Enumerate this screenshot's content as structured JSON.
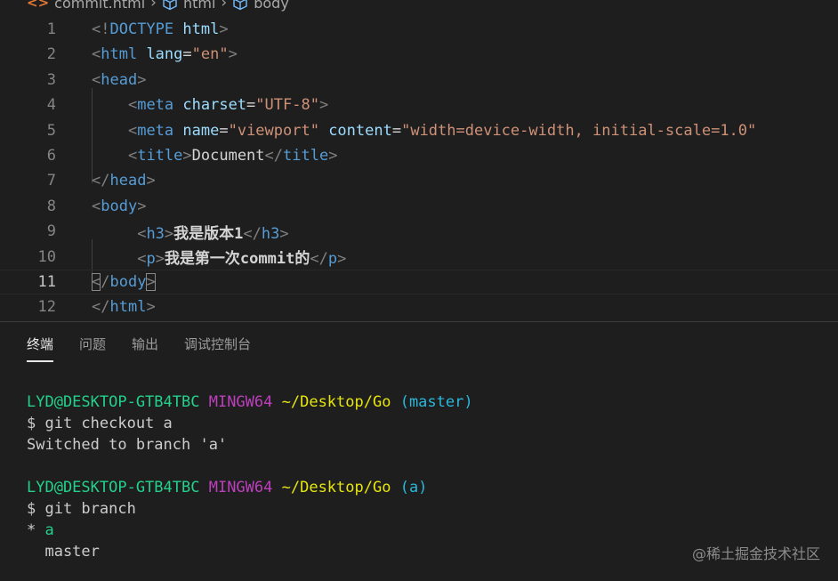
{
  "breadcrumb": {
    "file": "commit.html",
    "items": [
      "html",
      "body"
    ]
  },
  "editor": {
    "current_line": 11,
    "lines": [
      {
        "n": "1",
        "tokens": [
          [
            "b",
            "<!"
          ],
          [
            "t",
            "DOCTYPE "
          ],
          [
            "a",
            "html"
          ],
          [
            "b",
            ">"
          ]
        ]
      },
      {
        "n": "2",
        "tokens": [
          [
            "b",
            "<"
          ],
          [
            "t",
            "html "
          ],
          [
            "a",
            "lang"
          ],
          [
            "x",
            "="
          ],
          [
            "s",
            "\"en\""
          ],
          [
            "b",
            ">"
          ]
        ]
      },
      {
        "n": "3",
        "tokens": [
          [
            "b",
            "<"
          ],
          [
            "t",
            "head"
          ],
          [
            "b",
            ">"
          ]
        ]
      },
      {
        "n": "4",
        "tokens": [
          [
            "x",
            "    "
          ],
          [
            "b",
            "<"
          ],
          [
            "t",
            "meta "
          ],
          [
            "a",
            "charset"
          ],
          [
            "x",
            "="
          ],
          [
            "s",
            "\"UTF-8\""
          ],
          [
            "b",
            ">"
          ]
        ]
      },
      {
        "n": "5",
        "tokens": [
          [
            "x",
            "    "
          ],
          [
            "b",
            "<"
          ],
          [
            "t",
            "meta "
          ],
          [
            "a",
            "name"
          ],
          [
            "x",
            "="
          ],
          [
            "s",
            "\"viewport\" "
          ],
          [
            "a",
            "content"
          ],
          [
            "x",
            "="
          ],
          [
            "s",
            "\"width=device-width, initial-scale=1.0\""
          ]
        ]
      },
      {
        "n": "6",
        "tokens": [
          [
            "x",
            "    "
          ],
          [
            "b",
            "<"
          ],
          [
            "t",
            "title"
          ],
          [
            "b",
            ">"
          ],
          [
            "x",
            "Document"
          ],
          [
            "b",
            "</"
          ],
          [
            "t",
            "title"
          ],
          [
            "b",
            ">"
          ]
        ]
      },
      {
        "n": "7",
        "tokens": [
          [
            "b",
            "</"
          ],
          [
            "t",
            "head"
          ],
          [
            "b",
            ">"
          ]
        ]
      },
      {
        "n": "8",
        "tokens": [
          [
            "b",
            "<"
          ],
          [
            "t",
            "body"
          ],
          [
            "b",
            ">"
          ]
        ]
      },
      {
        "n": "9",
        "tokens": [
          [
            "x",
            "     "
          ],
          [
            "b",
            "<"
          ],
          [
            "t",
            "h3"
          ],
          [
            "b",
            ">"
          ],
          [
            "xb",
            "我是版本1"
          ],
          [
            "b",
            "</"
          ],
          [
            "t",
            "h3"
          ],
          [
            "b",
            ">"
          ]
        ]
      },
      {
        "n": "10",
        "tokens": [
          [
            "x",
            "     "
          ],
          [
            "b",
            "<"
          ],
          [
            "t",
            "p"
          ],
          [
            "b",
            ">"
          ],
          [
            "xb",
            "我是第一次commit的"
          ],
          [
            "b",
            "</"
          ],
          [
            "t",
            "p"
          ],
          [
            "b",
            ">"
          ]
        ]
      },
      {
        "n": "11",
        "tokens": [
          [
            "bbox",
            "<"
          ],
          [
            "b",
            "/"
          ],
          [
            "t",
            "body"
          ],
          [
            "bbox",
            ">"
          ]
        ]
      },
      {
        "n": "12",
        "tokens": [
          [
            "b",
            "</"
          ],
          [
            "t",
            "html"
          ],
          [
            "b",
            ">"
          ]
        ]
      }
    ]
  },
  "panel": {
    "tabs": [
      "终端",
      "问题",
      "输出",
      "调试控制台"
    ],
    "active_tab": 0
  },
  "terminal": {
    "lines": [
      [
        [
          "user",
          "LYD@DESKTOP-GTB4TBC"
        ],
        [
          "plain",
          " "
        ],
        [
          "ming",
          "MINGW64"
        ],
        [
          "plain",
          " "
        ],
        [
          "path",
          "~/Desktop/Go"
        ],
        [
          "plain",
          " "
        ],
        [
          "branch",
          "(master)"
        ]
      ],
      [
        [
          "plain",
          "$ git checkout a"
        ]
      ],
      [
        [
          "plain",
          "Switched to branch 'a'"
        ]
      ],
      [
        [
          "plain",
          ""
        ]
      ],
      [
        [
          "user",
          "LYD@DESKTOP-GTB4TBC"
        ],
        [
          "plain",
          " "
        ],
        [
          "ming",
          "MINGW64"
        ],
        [
          "plain",
          " "
        ],
        [
          "path",
          "~/Desktop/Go"
        ],
        [
          "plain",
          " "
        ],
        [
          "branch",
          "(a)"
        ]
      ],
      [
        [
          "plain",
          "$ git branch"
        ]
      ],
      [
        [
          "plain",
          "* "
        ],
        [
          "green",
          "a"
        ]
      ],
      [
        [
          "plain",
          "  master"
        ]
      ]
    ]
  },
  "watermark": "@稀土掘金技术社区",
  "colors": {
    "background": "#1e1e1e",
    "tag": "#569cd6",
    "attribute": "#9cdcfe",
    "string": "#ce9178",
    "user": "#23d18b",
    "mingw": "#bc3fbc",
    "path": "#e5e510",
    "branch": "#29b8db"
  }
}
